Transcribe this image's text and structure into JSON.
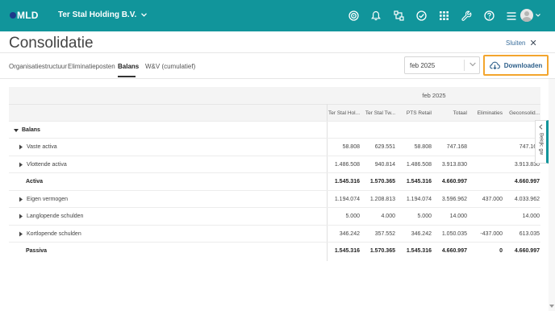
{
  "app": {
    "logo_text": "MLD",
    "company_name": "Ter Stal Holding B.V."
  },
  "topbar_icons": [
    "target-icon",
    "bell-icon",
    "workflow-icon",
    "check-circle-icon",
    "apps-grid-icon",
    "wrench-icon",
    "help-icon",
    "menu-icon"
  ],
  "page": {
    "title": "Consolidatie",
    "close_label": "Sluiten"
  },
  "tabs": [
    {
      "label": "Organisatiestructuur",
      "active": false
    },
    {
      "label": "Eliminatieposten",
      "active": false
    },
    {
      "label": "Balans",
      "active": true
    },
    {
      "label": "W&V (cumulatief)",
      "active": false
    }
  ],
  "month_select": {
    "value": "feb 2025"
  },
  "download": {
    "label": "Downloaden"
  },
  "table": {
    "period": "feb 2025",
    "columns": [
      "Ter Stal Hol...",
      "Ter Stal Tw...",
      "PTS Retail",
      "Totaal",
      "Eliminaties",
      "Geconsolid..."
    ],
    "section": "Balans",
    "rows": [
      {
        "label": "Vaste activa",
        "expandable": true,
        "bold": false,
        "values": [
          "58.808",
          "629.551",
          "58.808",
          "747.168",
          "",
          "747.168"
        ]
      },
      {
        "label": "Vlottende activa",
        "expandable": true,
        "bold": false,
        "values": [
          "1.486.508",
          "940.814",
          "1.486.508",
          "3.913.830",
          "",
          "3.913.830"
        ]
      },
      {
        "label": "Activa",
        "expandable": false,
        "bold": true,
        "values": [
          "1.545.316",
          "1.570.365",
          "1.545.316",
          "4.660.997",
          "",
          "4.660.997"
        ]
      },
      {
        "label": "Eigen vermogen",
        "expandable": true,
        "bold": false,
        "values": [
          "1.194.074",
          "1.208.813",
          "1.194.074",
          "3.596.962",
          "437.000",
          "4.033.962"
        ]
      },
      {
        "label": "Langlopende schulden",
        "expandable": true,
        "bold": false,
        "values": [
          "5.000",
          "4.000",
          "5.000",
          "14.000",
          "",
          "14.000"
        ]
      },
      {
        "label": "Kortlopende schulden",
        "expandable": true,
        "bold": false,
        "values": [
          "346.242",
          "357.552",
          "346.242",
          "1.050.035",
          "-437.000",
          "613.035"
        ]
      },
      {
        "label": "Passiva",
        "expandable": false,
        "bold": true,
        "values": [
          "1.545.316",
          "1.570.365",
          "1.545.316",
          "4.660.997",
          "0",
          "4.660.997"
        ]
      }
    ]
  },
  "side_panel": {
    "label": "Bekijk: gw"
  },
  "colors": {
    "topbar": "#11959b",
    "highlight_border": "#f3a52d",
    "link": "#3a6e9c"
  }
}
